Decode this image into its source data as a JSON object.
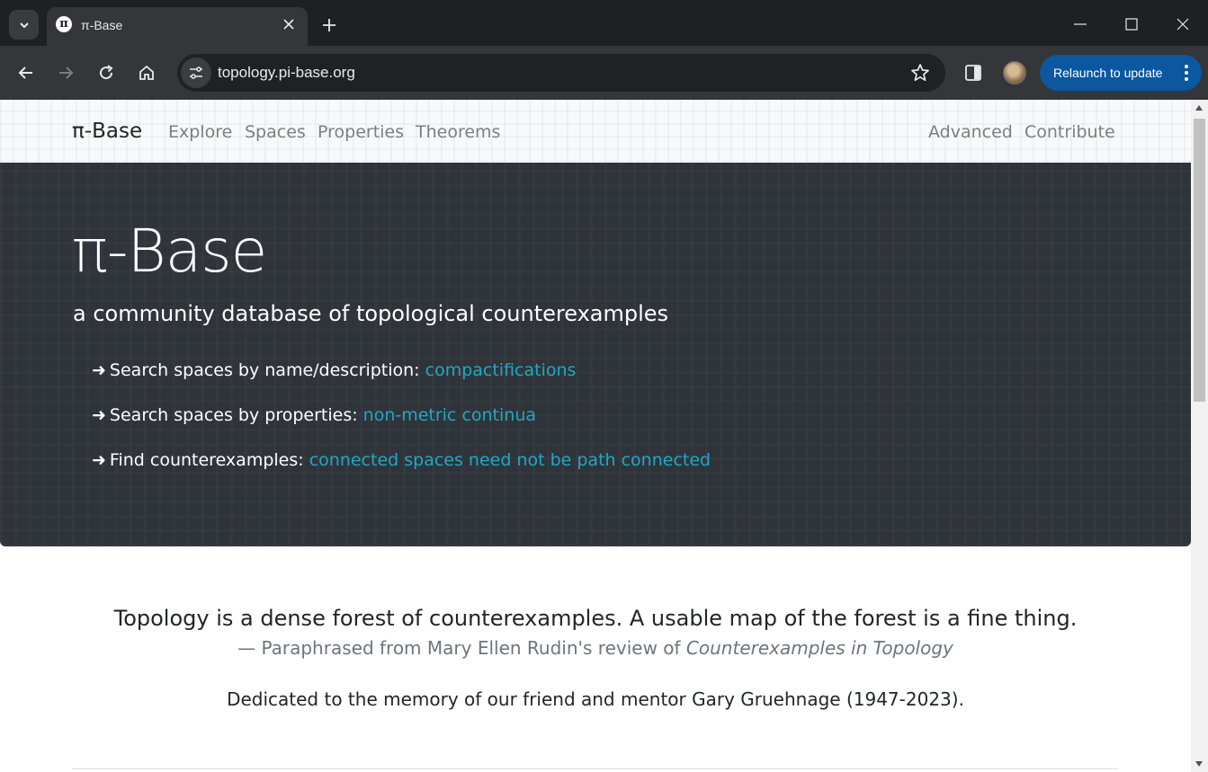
{
  "browser": {
    "tab_title": "π-Base",
    "tab_favicon_glyph": "π",
    "url": "topology.pi-base.org",
    "relaunch_label": "Relaunch to update",
    "accent_color": "#0b57a0"
  },
  "navbar": {
    "brand": "π-Base",
    "left_links": [
      "Explore",
      "Spaces",
      "Properties",
      "Theorems"
    ],
    "right_links": [
      "Advanced",
      "Contribute"
    ]
  },
  "hero": {
    "title": "π-Base",
    "subtitle": "a community database of topological counterexamples",
    "arrow": "➜",
    "items": [
      {
        "label": "Search spaces by name/description: ",
        "link": "compactifications"
      },
      {
        "label": "Search spaces by properties: ",
        "link": "non-metric continua"
      },
      {
        "label": "Find counterexamples: ",
        "link": "connected spaces need not be path connected"
      }
    ],
    "link_color": "#20a8c3"
  },
  "content": {
    "quote": "Topology is a dense forest of counterexamples. A usable map of the forest is a fine thing.",
    "attribution_prefix": "— Paraphrased from Mary Ellen Rudin's review of ",
    "attribution_work": "Counterexamples in Topology",
    "dedication": "Dedicated to the memory of our friend and mentor Gary Gruehnage (1947-2023)."
  }
}
